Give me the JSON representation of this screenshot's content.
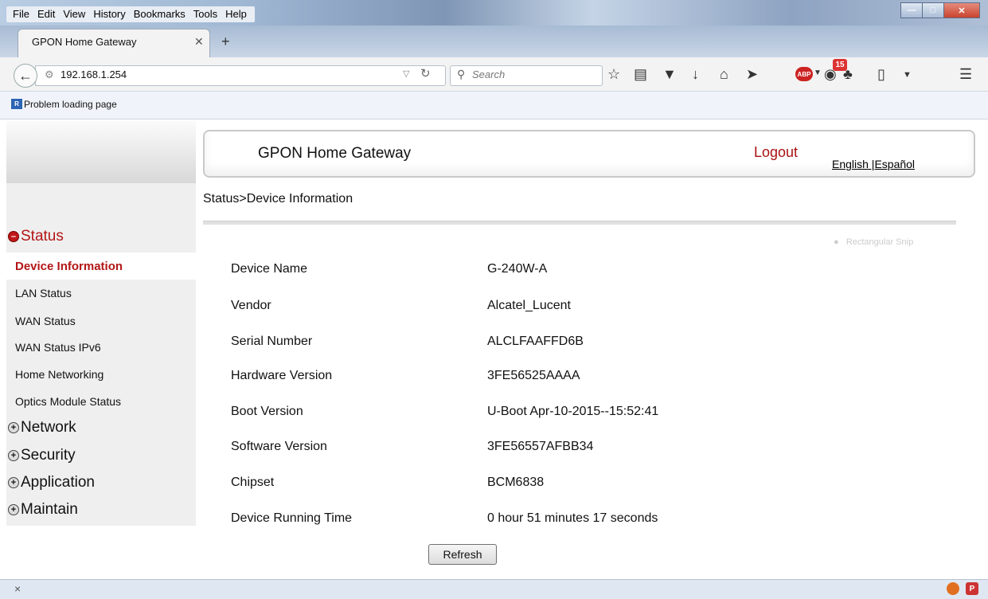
{
  "browser": {
    "menu": [
      "File",
      "Edit",
      "View",
      "History",
      "Bookmarks",
      "Tools",
      "Help"
    ],
    "tab_title": "GPON Home Gateway",
    "url": "192.168.1.254",
    "search_placeholder": "Search",
    "notification_count": "15",
    "adblock_label": "ABP",
    "bookmark_label": "Problem loading page"
  },
  "header": {
    "title": "GPON Home Gateway",
    "logout": "Logout",
    "lang_english": "English",
    "lang_sep": " |",
    "lang_spanish": "Español"
  },
  "breadcrumb": "Status>Device Information",
  "snip_overlay": "Rectangular Snip",
  "sidebar": {
    "status": "Status",
    "status_items": [
      "Device Information",
      "LAN Status",
      "WAN Status",
      "WAN Status IPv6",
      "Home Networking",
      "Optics Module Status"
    ],
    "sections": [
      "Network",
      "Security",
      "Application",
      "Maintain"
    ]
  },
  "device_info": [
    {
      "label": "Device Name",
      "value": "G-240W-A"
    },
    {
      "label": "Vendor",
      "value": "Alcatel_Lucent"
    },
    {
      "label": "Serial Number",
      "value": "ALCLFAAFFD6B"
    },
    {
      "label": "Hardware Version",
      "value": "3FE56525AAAA"
    },
    {
      "label": "Boot Version",
      "value": "U-Boot Apr-10-2015--15:52:41"
    },
    {
      "label": "Software Version",
      "value": "3FE56557AFBB34"
    },
    {
      "label": "Chipset",
      "value": "BCM6838"
    },
    {
      "label": "Device Running Time",
      "value": "0 hour 51 minutes 17 seconds"
    }
  ],
  "refresh_label": "Refresh",
  "statusbar_close": "×",
  "colors": {
    "accent_red": "#b31616",
    "sidebar_bg": "#efefef"
  }
}
